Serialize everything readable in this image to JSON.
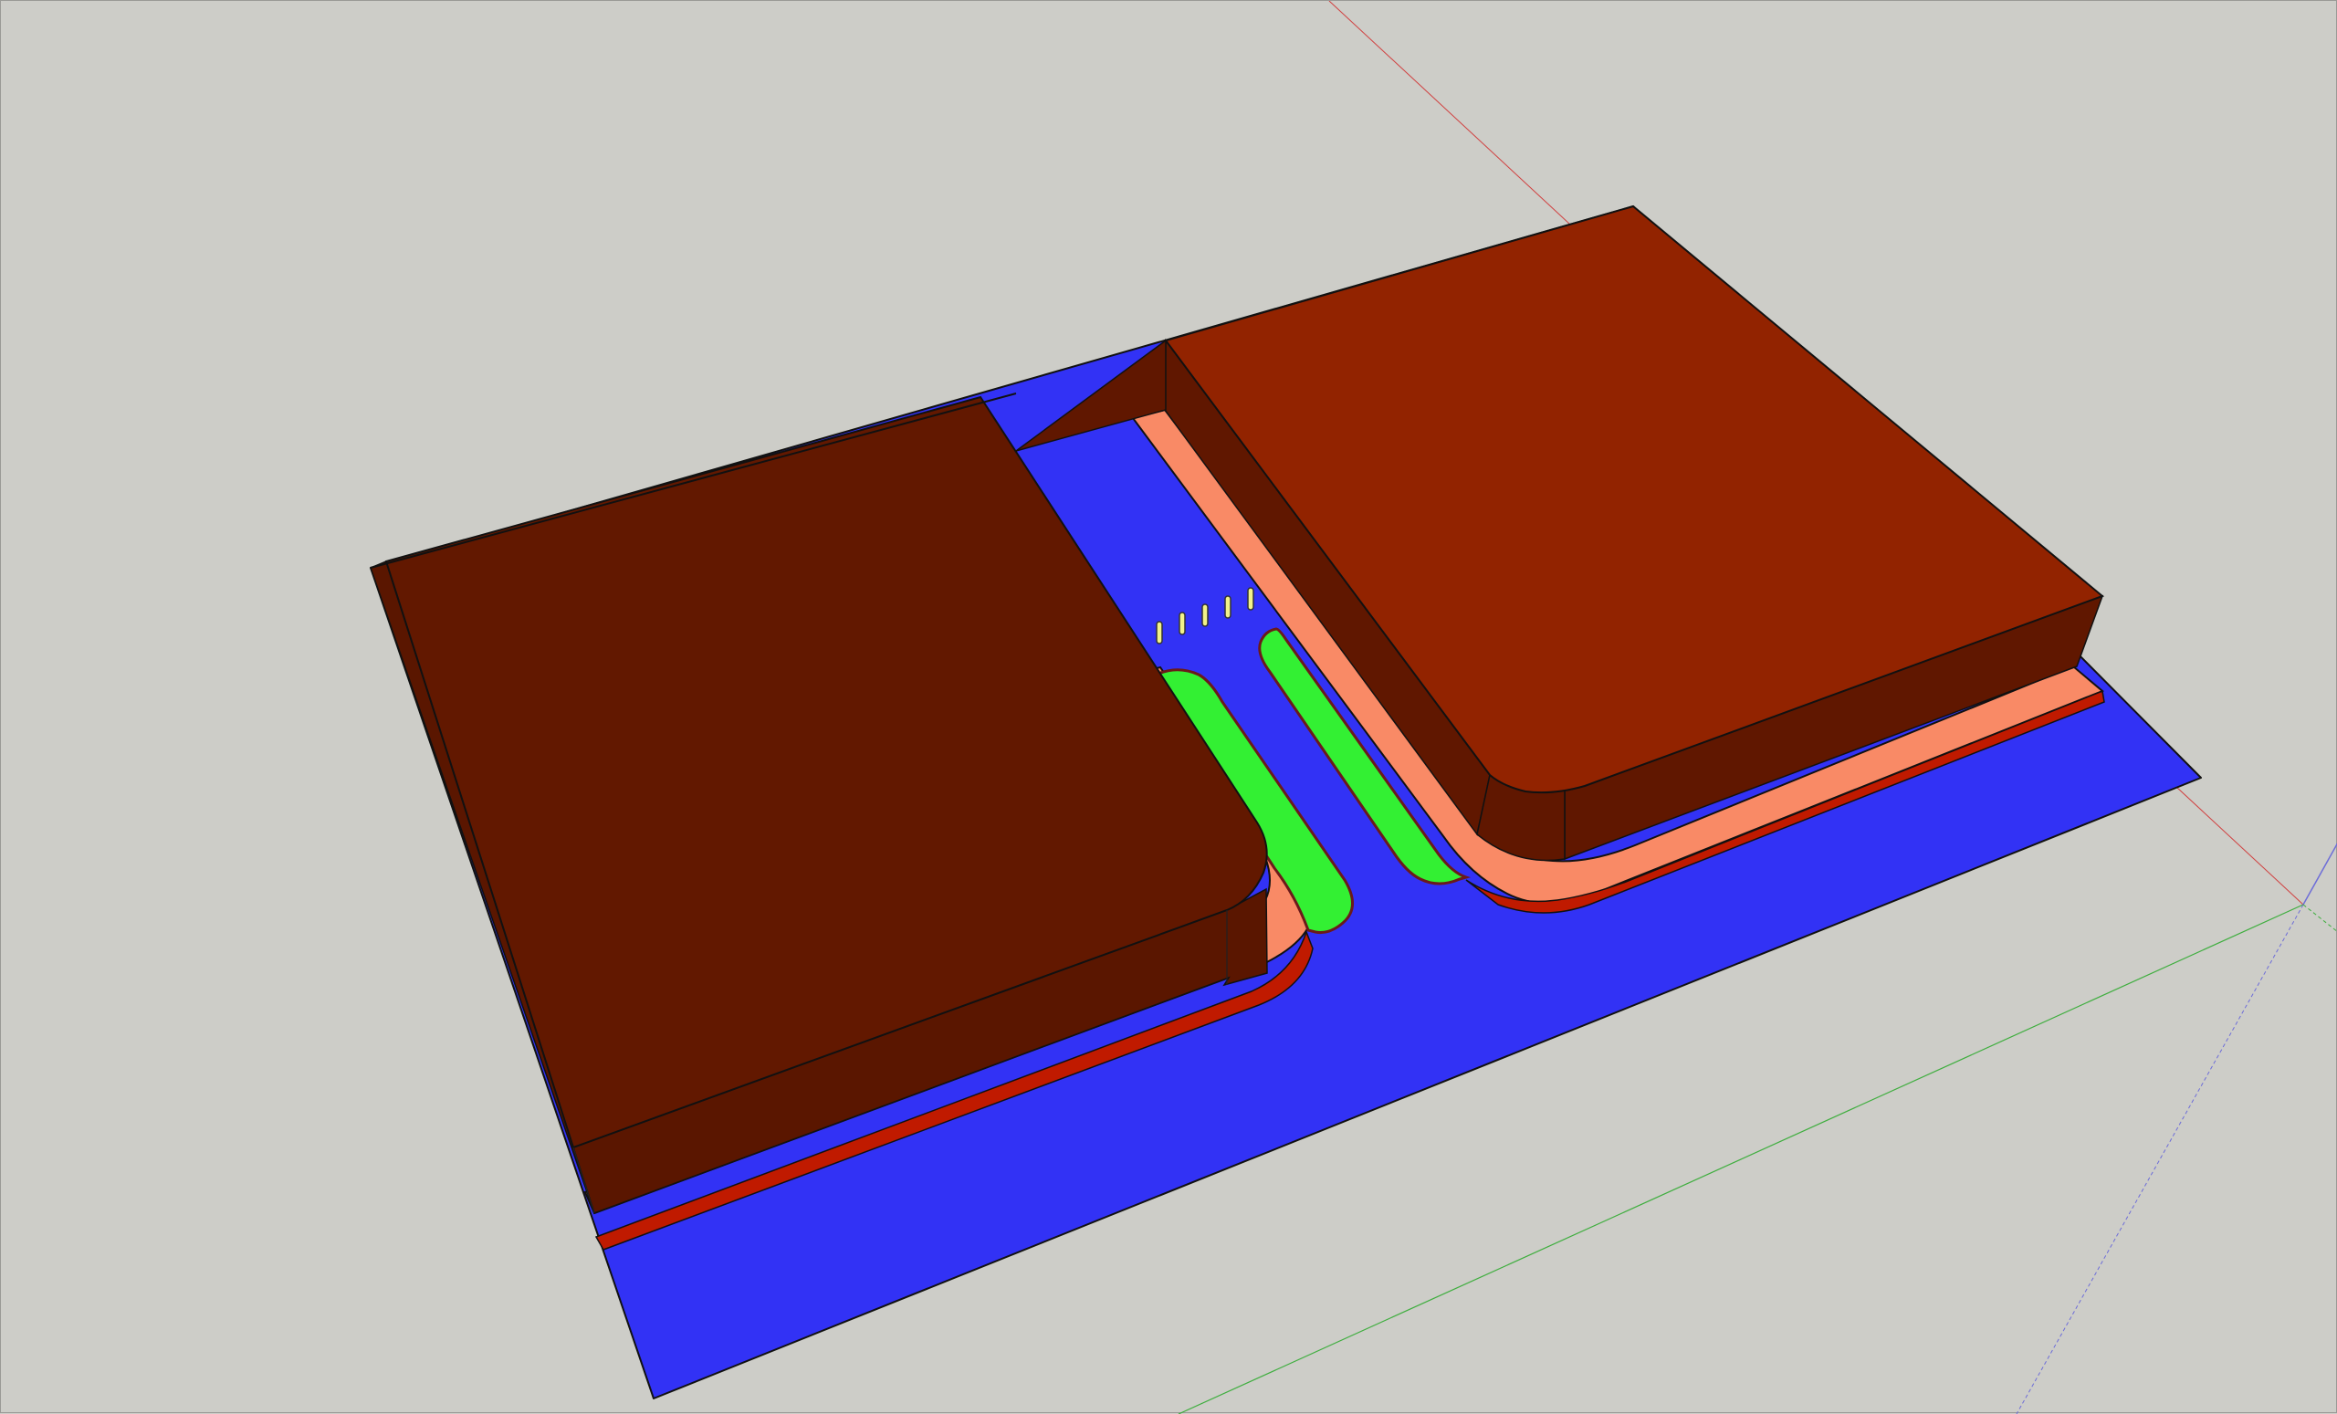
{
  "viewport": {
    "background": "#cdcdc8",
    "axes": {
      "red": "#d04040",
      "green": "#3fae3f",
      "blue": "#6d6dd8"
    }
  },
  "model": {
    "colors": {
      "base_plate": "#3232f5",
      "left_block_top": "#621800",
      "left_block_side": "#5a1600",
      "right_block_top": "#922300",
      "right_block_side": "#601700",
      "contact_strip": "#f98a66",
      "contact_strip_edge": "#c01a00",
      "channel": "#33f033",
      "pins": "#f2f28a",
      "edges": "#111111"
    },
    "pin_count": 5,
    "channel_count": 2
  }
}
